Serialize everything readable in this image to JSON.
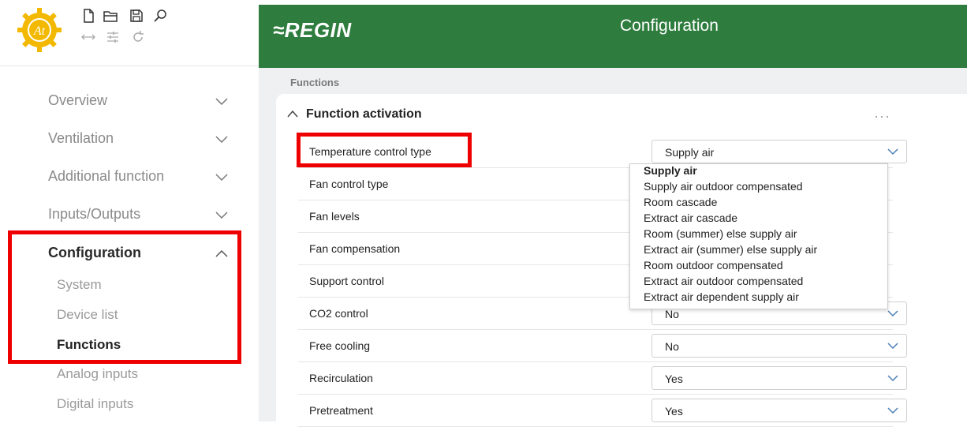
{
  "header": {
    "brand": "≈REGIN",
    "title": "Configuration",
    "color": "#2e7d3e"
  },
  "toolbar": {
    "logo_text": "At",
    "icons": [
      "new-file-icon",
      "open-folder-icon",
      "save-icon",
      "search-icon",
      "connect-icon",
      "settings-sliders-icon",
      "refresh-icon"
    ]
  },
  "sidebar": {
    "items": [
      {
        "label": "Overview"
      },
      {
        "label": "Ventilation"
      },
      {
        "label": "Additional function"
      },
      {
        "label": "Inputs/Outputs"
      },
      {
        "label": "Configuration",
        "expanded": true
      }
    ],
    "subitems": [
      {
        "label": "System"
      },
      {
        "label": "Device list"
      },
      {
        "label": "Functions",
        "active": true
      },
      {
        "label": "Analog inputs"
      },
      {
        "label": "Digital inputs"
      }
    ]
  },
  "breadcrumb": "Functions",
  "section": {
    "title": "Function activation",
    "more": "···"
  },
  "rows": [
    {
      "label": "Temperature control type",
      "value": "Supply air"
    },
    {
      "label": "Fan control type",
      "value": ""
    },
    {
      "label": "Fan levels",
      "value": ""
    },
    {
      "label": "Fan compensation",
      "value": ""
    },
    {
      "label": "Support control",
      "value": ""
    },
    {
      "label": "CO2 control",
      "value": "No"
    },
    {
      "label": "Free cooling",
      "value": "No"
    },
    {
      "label": "Recirculation",
      "value": "Yes"
    },
    {
      "label": "Pretreatment",
      "value": "Yes"
    }
  ],
  "dropdown_options": [
    "Supply air",
    "Supply air outdoor compensated",
    "Room cascade",
    "Extract air cascade",
    "Room (summer) else supply air",
    "Extract air (summer) else supply air",
    "Room outdoor compensated",
    "Extract air outdoor compensated",
    "Extract air dependent supply air"
  ],
  "highlight_color": "#ee0000"
}
